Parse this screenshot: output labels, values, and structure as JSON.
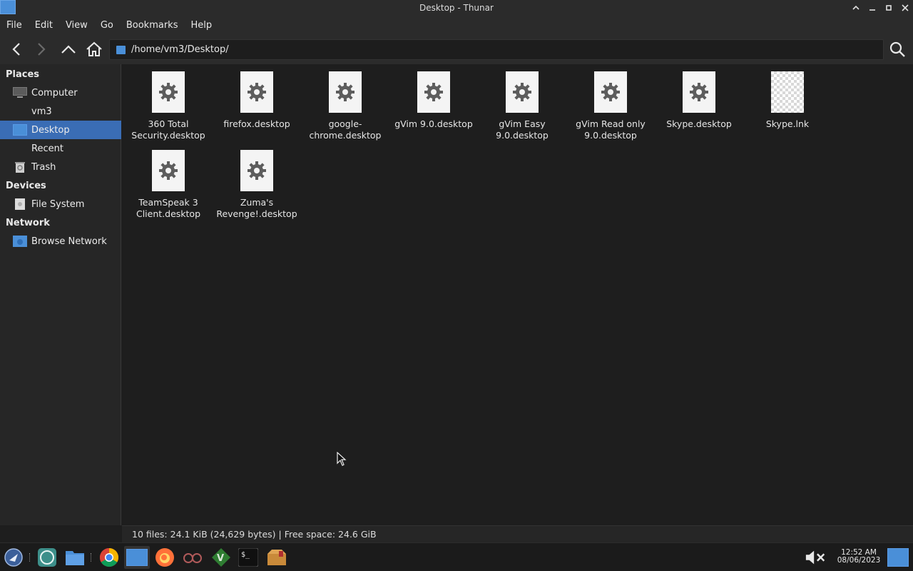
{
  "window": {
    "title": "Desktop - Thunar",
    "controls": [
      "restore",
      "minimize",
      "maximize",
      "close"
    ]
  },
  "menu": {
    "items": [
      "File",
      "Edit",
      "View",
      "Go",
      "Bookmarks",
      "Help"
    ]
  },
  "toolbar": {
    "path": "/home/vm3/Desktop/"
  },
  "sidebar": {
    "places_title": "Places",
    "devices_title": "Devices",
    "network_title": "Network",
    "places": [
      {
        "label": "Computer",
        "icon": "computer-icon"
      },
      {
        "label": "vm3",
        "icon": "home-icon"
      },
      {
        "label": "Desktop",
        "icon": "desktop-folder-icon",
        "active": true
      },
      {
        "label": "Recent",
        "icon": "recent-icon"
      },
      {
        "label": "Trash",
        "icon": "trash-icon"
      }
    ],
    "devices": [
      {
        "label": "File System",
        "icon": "drive-icon"
      }
    ],
    "network": [
      {
        "label": "Browse Network",
        "icon": "network-folder-icon"
      }
    ]
  },
  "files": [
    {
      "name": "360 Total\nSecurity.desktop",
      "icon": "gear-icon"
    },
    {
      "name": "firefox.desktop",
      "icon": "gear-icon"
    },
    {
      "name": "google-\nchrome.desktop",
      "icon": "gear-icon"
    },
    {
      "name": "gVim 9.0.desktop",
      "icon": "gear-icon"
    },
    {
      "name": "gVim Easy\n9.0.desktop",
      "icon": "gear-icon"
    },
    {
      "name": "gVim Read only\n9.0.desktop",
      "icon": "gear-icon"
    },
    {
      "name": "Skype.desktop",
      "icon": "gear-icon"
    },
    {
      "name": "Skype.lnk",
      "icon": "blank-file-icon"
    },
    {
      "name": "TeamSpeak 3\nClient.desktop",
      "icon": "gear-icon"
    },
    {
      "name": "Zuma's\nRevenge!.desktop",
      "icon": "gear-icon"
    }
  ],
  "status": {
    "text": "10 files: 24.1 KiB (24,629 bytes)  |  Free space: 24.6 GiB"
  },
  "taskbar": {
    "apps": [
      "start-menu-icon",
      "safari-compass-icon",
      "files-icon",
      "chrome-icon",
      "thunar-window-icon",
      "firefox-icon",
      "glasses-icon",
      "vim-icon",
      "terminal-icon",
      "archive-icon"
    ],
    "clock_time": "12:52 AM",
    "clock_date": "08/06/2023"
  },
  "colors": {
    "accent": "#3a6db5",
    "folder": "#4a8fd8",
    "background": "#1e1e1e"
  }
}
